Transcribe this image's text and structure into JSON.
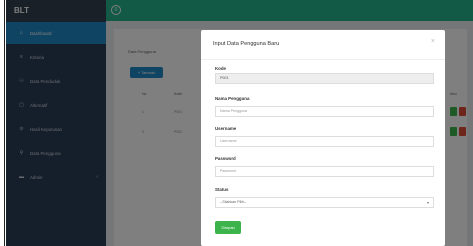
{
  "brand": "BLT",
  "sidebar": {
    "items": [
      {
        "label": "Dashboard",
        "icon": "home-icon",
        "glyph": "⌂",
        "active": true
      },
      {
        "label": "Kriteria",
        "icon": "list-icon",
        "glyph": "≡"
      },
      {
        "label": "Data Penduduk",
        "icon": "users-icon",
        "glyph": "⚇"
      },
      {
        "label": "Alternatif",
        "icon": "file-icon",
        "glyph": "▢"
      },
      {
        "label": "Hasil Keputusan",
        "icon": "check-icon",
        "glyph": "⊙"
      },
      {
        "label": "Data Pengguna",
        "icon": "user-icon",
        "glyph": "⚲"
      },
      {
        "label": "Admin",
        "icon": "admin-icon",
        "glyph": "▬",
        "chevron": "‹"
      }
    ]
  },
  "topbar": {
    "menu_glyph": "≡"
  },
  "background": {
    "page_title": "Data Pengguna",
    "add_label": "+ Tambah",
    "headers": [
      "No",
      "Kode"
    ],
    "rows": [
      {
        "no": "1",
        "kode": "P001"
      },
      {
        "no": "2",
        "kode": "P002"
      }
    ],
    "action_header": "Aksi",
    "colors": {
      "edit": "#3cb44b",
      "delete": "#dd4b39"
    }
  },
  "modal": {
    "title": "Input Data Pengguna Baru",
    "close": "×",
    "kode_label": "Kode",
    "kode_value": "P003",
    "nama_label": "Nama Pengguna",
    "nama_placeholder": "Nama Pengguna",
    "username_label": "Username",
    "username_placeholder": "Username",
    "password_label": "Password",
    "password_placeholder": "Password",
    "status_label": "Status",
    "status_value": "--Silahkan Pilih--",
    "submit_label": "Simpan"
  }
}
